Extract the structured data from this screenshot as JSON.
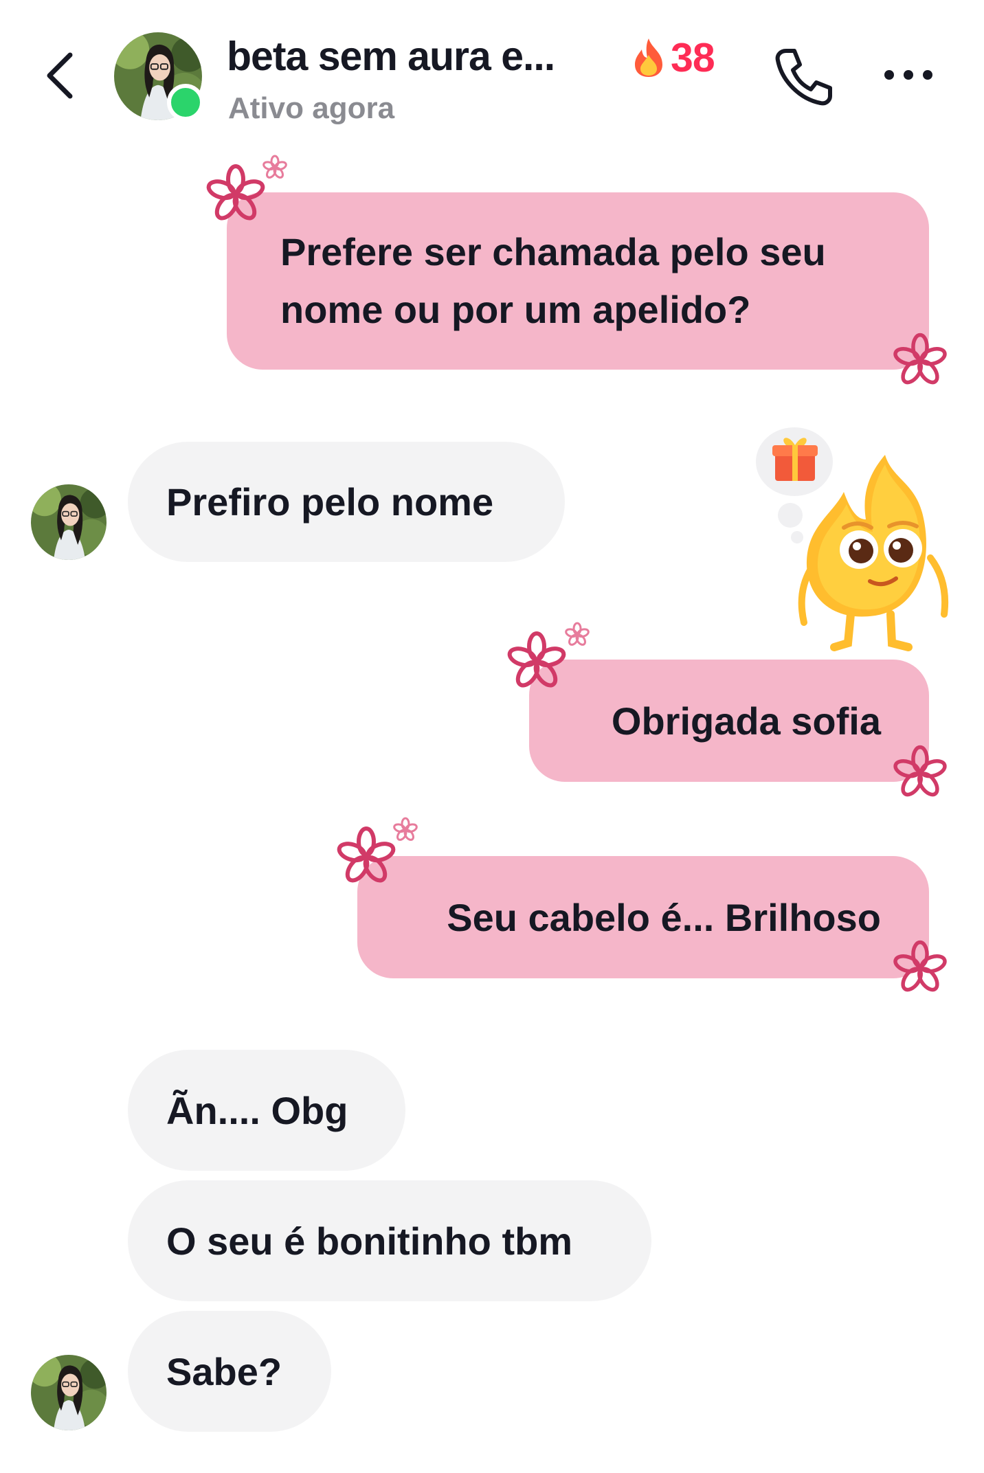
{
  "header": {
    "back_icon": "chevron-left-icon",
    "contact_name": "beta sem aura e...",
    "status": "Ativo agora",
    "streak_icon": "fire-icon",
    "streak_count": "38",
    "call_icon": "phone-icon",
    "more_icon": "more-horizontal-icon"
  },
  "messages": [
    {
      "direction": "outgoing",
      "lines": [
        "Prefere ser chamada pelo seu",
        "nome ou por um apelido?"
      ]
    },
    {
      "direction": "incoming",
      "text": "Prefiro pelo nome"
    },
    {
      "direction": "outgoing",
      "text": "Obrigada sofia"
    },
    {
      "direction": "outgoing",
      "text": "Seu cabelo é... Brilhoso"
    },
    {
      "direction": "incoming",
      "text": "Ãn.... Obg"
    },
    {
      "direction": "incoming",
      "text": "O seu é bonitinho tbm"
    },
    {
      "direction": "incoming",
      "text": "Sabe?"
    }
  ],
  "decorations": {
    "flower_icon": "flower-icon",
    "mascot_icon": "flame-mascot-icon",
    "thought_icon": "gift-icon"
  },
  "colors": {
    "outgoing_bubble": "#f5b6c9",
    "incoming_bubble": "#f3f3f4",
    "accent": "#fe2c55",
    "online": "#2bd46b"
  }
}
